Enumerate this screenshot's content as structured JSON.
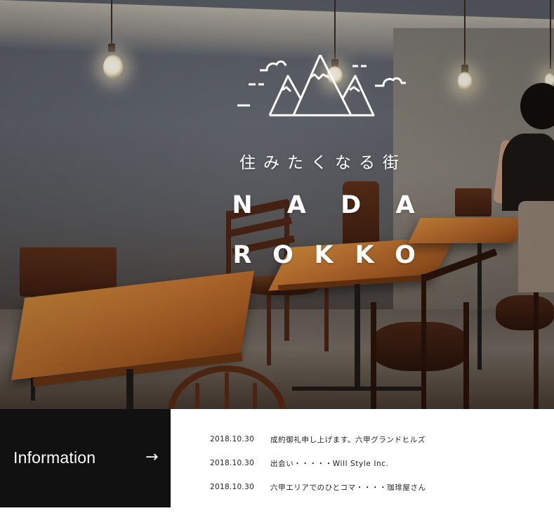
{
  "hero": {
    "tagline": "住みたくなる街",
    "title_line1": [
      "N",
      "A",
      "D",
      "A"
    ],
    "title_line2": [
      "R",
      "O",
      "K",
      "K",
      "O"
    ]
  },
  "info": {
    "label": "Information",
    "arrow": "→",
    "news": [
      {
        "date": "2018.10.30",
        "title": "成約御礼申し上げます。六甲グランドヒルズ"
      },
      {
        "date": "2018.10.30",
        "title": "出会い・・・・・Will Style Inc."
      },
      {
        "date": "2018.10.30",
        "title": "六甲エリアでのひとコマ・・・・珈琲屋さん"
      }
    ]
  },
  "colors": {
    "info_panel": "#111111",
    "text_light": "#ffffff",
    "text_dark": "#222222"
  },
  "icons": [
    "mountain-logo-icon",
    "arrow-right-icon"
  ]
}
